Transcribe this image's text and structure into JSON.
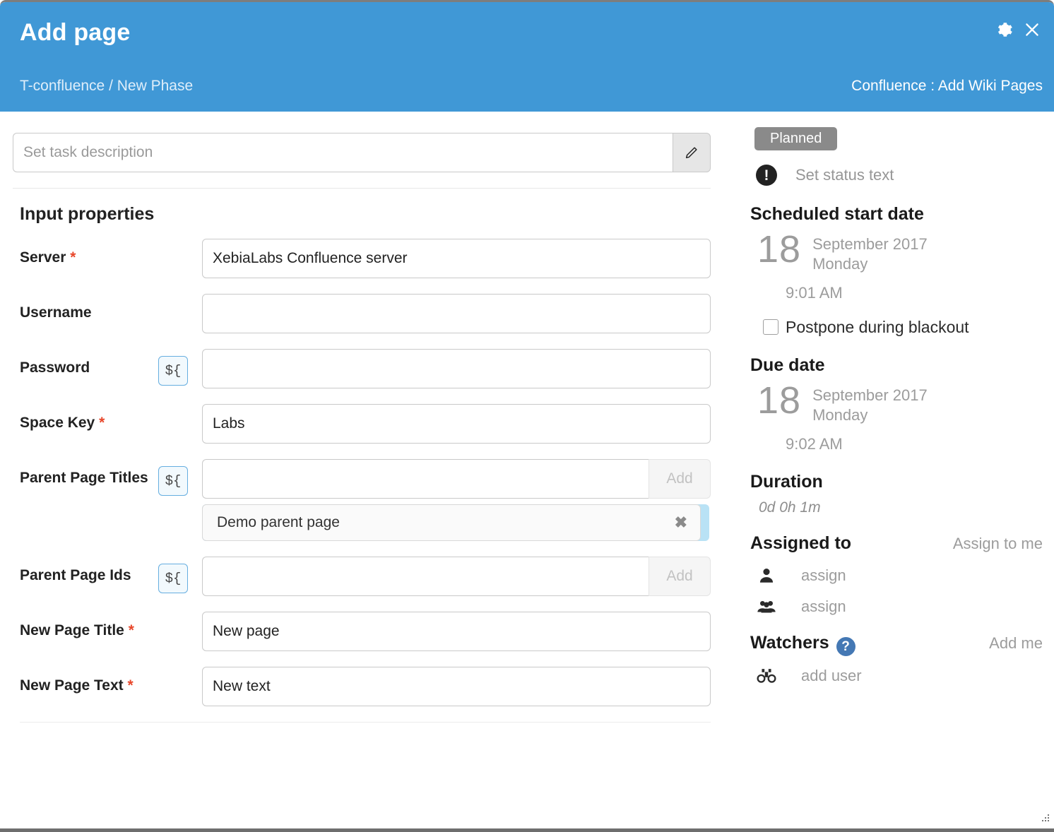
{
  "header": {
    "title": "Add page",
    "breadcrumb": "T-confluence / New Phase",
    "right_label": "Confluence : Add Wiki Pages",
    "gear_icon": "gear-icon",
    "close_icon": "close-icon",
    "background_color": "#4098d6"
  },
  "description": {
    "placeholder": "Set task description",
    "value": "",
    "edit_icon": "pencil-icon"
  },
  "input_properties": {
    "section_title": "Input properties",
    "fields": [
      {
        "label": "Server",
        "required": true,
        "has_variable_button": false,
        "variable_button_label": "${",
        "value": "XebiaLabs Confluence server",
        "placeholder": "",
        "has_add_button": false,
        "chips": []
      },
      {
        "label": "Username",
        "required": false,
        "has_variable_button": false,
        "variable_button_label": "${",
        "value": "",
        "placeholder": "",
        "has_add_button": false,
        "chips": []
      },
      {
        "label": "Password",
        "required": false,
        "has_variable_button": true,
        "variable_button_label": "${",
        "value": "",
        "placeholder": "",
        "has_add_button": false,
        "chips": []
      },
      {
        "label": "Space Key",
        "required": true,
        "has_variable_button": false,
        "variable_button_label": "${",
        "value": "Labs",
        "placeholder": "",
        "has_add_button": false,
        "chips": []
      },
      {
        "label": "Parent Page Titles",
        "required": false,
        "has_variable_button": true,
        "variable_button_label": "${",
        "value": "",
        "placeholder": "",
        "has_add_button": true,
        "add_button_label": "Add",
        "chips": [
          "Demo parent page"
        ]
      },
      {
        "label": "Parent Page Ids",
        "required": false,
        "has_variable_button": true,
        "variable_button_label": "${",
        "value": "",
        "placeholder": "",
        "has_add_button": true,
        "add_button_label": "Add",
        "chips": []
      },
      {
        "label": "New Page Title",
        "required": true,
        "has_variable_button": false,
        "variable_button_label": "${",
        "value": "New page",
        "placeholder": "",
        "has_add_button": false,
        "chips": []
      },
      {
        "label": "New Page Text",
        "required": true,
        "has_variable_button": false,
        "variable_button_label": "${",
        "value": "New text",
        "placeholder": "",
        "has_add_button": false,
        "chips": []
      }
    ]
  },
  "sidebar": {
    "status_badge": "Planned",
    "status_badge_color": "#8a8a8a",
    "status_text": "Set status text",
    "status_icon": "exclamation-circle-icon",
    "scheduled_start": {
      "title": "Scheduled start date",
      "day": "18",
      "month_year": "September 2017",
      "weekday": "Monday",
      "time": "9:01 AM"
    },
    "postpone": {
      "label": "Postpone during blackout",
      "checked": false
    },
    "due_date": {
      "title": "Due date",
      "day": "18",
      "month_year": "September 2017",
      "weekday": "Monday",
      "time": "9:02 AM"
    },
    "duration": {
      "title": "Duration",
      "value": "0d 0h 1m"
    },
    "assigned_to": {
      "title": "Assigned to",
      "action": "Assign to me",
      "user_icon": "user-icon",
      "user_placeholder": "assign",
      "team_icon": "users-group-icon",
      "team_placeholder": "assign"
    },
    "watchers": {
      "title": "Watchers",
      "help_icon": "question-mark-icon",
      "help_icon_color": "#4478b4",
      "action": "Add me",
      "binoculars_icon": "binoculars-icon",
      "placeholder": "add user"
    }
  },
  "resize_handle": "resize-grip-icon"
}
